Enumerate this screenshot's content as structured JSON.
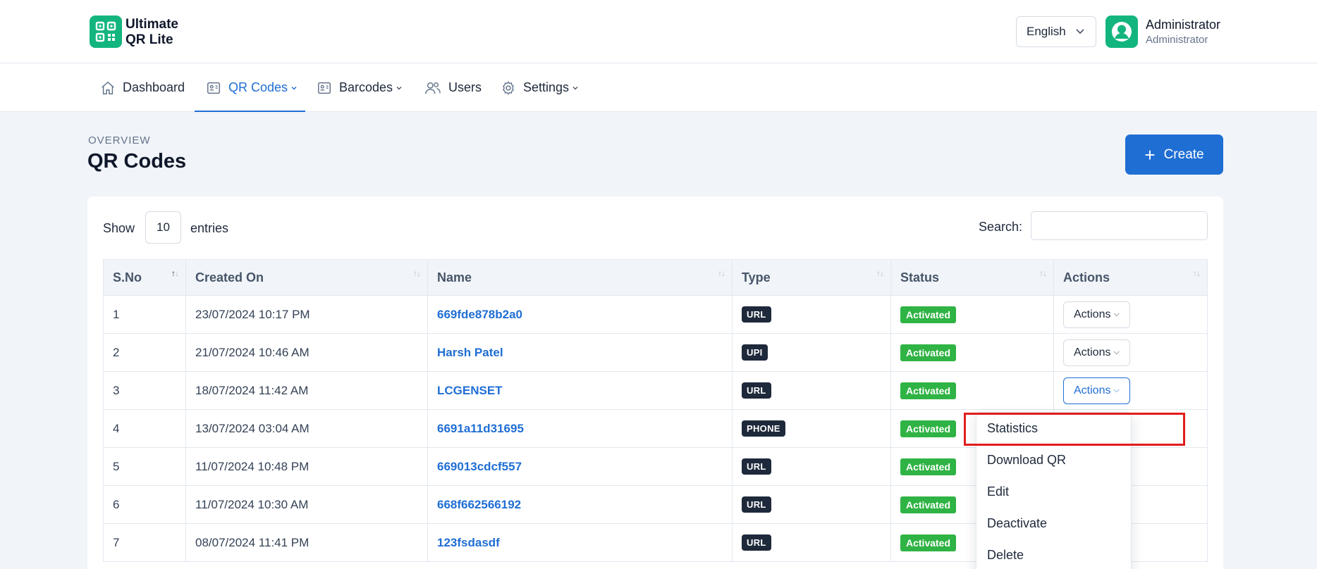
{
  "header": {
    "brand_line1": "Ultimate",
    "brand_line2": "QR Lite",
    "language": "English",
    "user_name": "Administrator",
    "user_role": "Administrator"
  },
  "nav": {
    "items": [
      {
        "label": "Dashboard",
        "icon": "home-icon",
        "active": false,
        "dropdown": false
      },
      {
        "label": "QR Codes",
        "icon": "id-card-icon",
        "active": true,
        "dropdown": true
      },
      {
        "label": "Barcodes",
        "icon": "id-card-icon",
        "active": false,
        "dropdown": true
      },
      {
        "label": "Users",
        "icon": "users-icon",
        "active": false,
        "dropdown": false
      },
      {
        "label": "Settings",
        "icon": "gear-icon",
        "active": false,
        "dropdown": true
      }
    ]
  },
  "page": {
    "overline": "OVERVIEW",
    "title": "QR Codes",
    "create_label": "Create"
  },
  "table_controls": {
    "show_label": "Show",
    "entries_value": "10",
    "entries_label": "entries",
    "search_label": "Search:",
    "search_value": ""
  },
  "table": {
    "columns": [
      "S.No",
      "Created On",
      "Name",
      "Type",
      "Status",
      "Actions"
    ],
    "rows": [
      {
        "sno": "1",
        "created": "23/07/2024 10:17 PM",
        "name": "669fde878b2a0",
        "type": "URL",
        "status": "Activated",
        "action": "Actions"
      },
      {
        "sno": "2",
        "created": "21/07/2024 10:46 AM",
        "name": "Harsh Patel",
        "type": "UPI",
        "status": "Activated",
        "action": "Actions"
      },
      {
        "sno": "3",
        "created": "18/07/2024 11:42 AM",
        "name": "LCGENSET",
        "type": "URL",
        "status": "Activated",
        "action": "Actions"
      },
      {
        "sno": "4",
        "created": "13/07/2024 03:04 AM",
        "name": "6691a11d31695",
        "type": "PHONE",
        "status": "Activated",
        "action": ""
      },
      {
        "sno": "5",
        "created": "11/07/2024 10:48 PM",
        "name": "669013cdcf557",
        "type": "URL",
        "status": "Activated",
        "action": ""
      },
      {
        "sno": "6",
        "created": "11/07/2024 10:30 AM",
        "name": "668f662566192",
        "type": "URL",
        "status": "Activated",
        "action": ""
      },
      {
        "sno": "7",
        "created": "08/07/2024 11:41 PM",
        "name": "123fsdasdf",
        "type": "URL",
        "status": "Activated",
        "action": ""
      }
    ]
  },
  "actions_menu": {
    "items": [
      "Statistics",
      "Download QR",
      "Edit",
      "Deactivate",
      "Delete"
    ]
  },
  "colors": {
    "accent": "#1f6ed4",
    "brand": "#13b57e",
    "status_active": "#2fb344",
    "highlight": "#e11d1d"
  }
}
